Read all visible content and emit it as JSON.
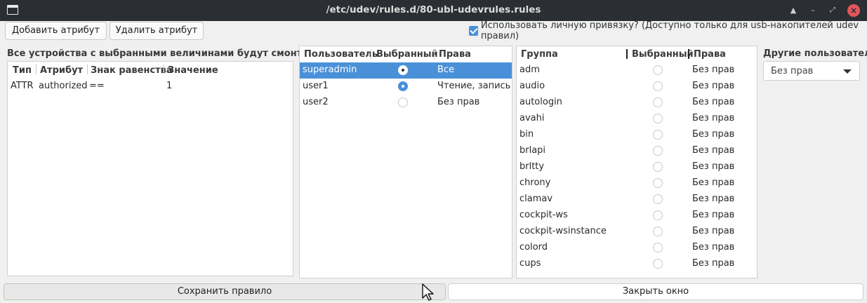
{
  "window": {
    "title": "/etc/udev/rules.d/80-ubl-udevrules.rules"
  },
  "toolbar": {
    "add_label": "Добавить атрибут",
    "remove_label": "Удалить атрибут",
    "personal_binding_label": "Использовать личную привязку? (Доступно только для usb-накопителей udev правил)",
    "personal_binding_checked": true
  },
  "attributes": {
    "section_label": "Все устройства с выбранными величинами будут смонтированы",
    "columns": [
      "Тип",
      "Атрибут",
      "Знак равенства",
      "Значение"
    ],
    "rows": [
      {
        "type": "ATTR",
        "attribute": "authorized",
        "op": "==",
        "value": "1"
      }
    ]
  },
  "users": {
    "columns": [
      "Пользователь",
      "Выбранный",
      "Права"
    ],
    "rows": [
      {
        "name": "superadmin",
        "selected": true,
        "rights": "Все",
        "highlight": true
      },
      {
        "name": "user1",
        "selected": true,
        "rights": "Чтение, запись",
        "highlight": false
      },
      {
        "name": "user2",
        "selected": false,
        "rights": "Без прав",
        "highlight": false
      }
    ]
  },
  "groups": {
    "columns": [
      "Группа",
      "Выбранный",
      "Права"
    ],
    "rows": [
      {
        "name": "adm",
        "rights": "Без прав"
      },
      {
        "name": "audio",
        "rights": "Без прав"
      },
      {
        "name": "autologin",
        "rights": "Без прав"
      },
      {
        "name": "avahi",
        "rights": "Без прав"
      },
      {
        "name": "bin",
        "rights": "Без прав"
      },
      {
        "name": "brlapi",
        "rights": "Без прав"
      },
      {
        "name": "brltty",
        "rights": "Без прав"
      },
      {
        "name": "chrony",
        "rights": "Без прав"
      },
      {
        "name": "clamav",
        "rights": "Без прав"
      },
      {
        "name": "cockpit-ws",
        "rights": "Без прав"
      },
      {
        "name": "cockpit-wsinstance",
        "rights": "Без прав"
      },
      {
        "name": "colord",
        "rights": "Без прав"
      },
      {
        "name": "cups",
        "rights": "Без прав"
      }
    ]
  },
  "others": {
    "label": "Другие пользователи",
    "selected": "Без прав"
  },
  "bottom": {
    "save_label": "Сохранить правило",
    "close_label": "Закрыть окно"
  },
  "colors": {
    "accent": "#4a90d9",
    "titlebar": "#2b2e33",
    "close": "#e0565b"
  }
}
